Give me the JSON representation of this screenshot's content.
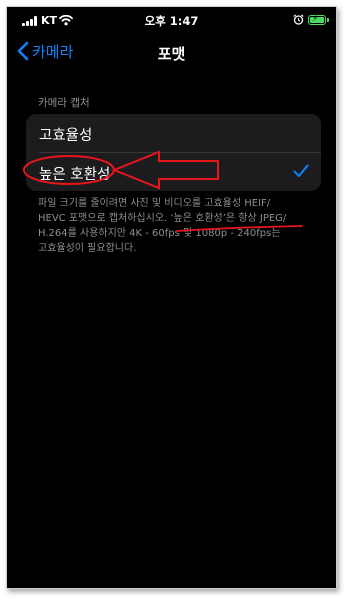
{
  "status_bar": {
    "carrier": "KT",
    "time": "오후 1:47",
    "icons": [
      "signal-icon",
      "wifi-icon",
      "alarm-icon",
      "battery-charging-icon"
    ]
  },
  "nav": {
    "back_label": "카메라",
    "title": "포맷"
  },
  "section": {
    "header": "카메라 캡처",
    "options": [
      {
        "label": "고효율성",
        "selected": false
      },
      {
        "label": "높은 호환성",
        "selected": true
      }
    ],
    "footer_lines": [
      "파일 크기를 줄이려면 사진 및 비디오를 고효율성 HEIF/",
      "HEVC 포맷으로 캡처하십시오. ‘높은 호환성’은 항상 JPEG/",
      "H.264를 사용하지만 4K - 60fps 및 1080p - 240fps는",
      "고효율성이 필요합니다."
    ]
  },
  "colors": {
    "accent": "#0a84ff",
    "background": "#000000",
    "group_background": "#1c1c1e",
    "secondary_text": "#8e8e93",
    "annotation": "#e8151b",
    "battery": "#4cd964"
  }
}
